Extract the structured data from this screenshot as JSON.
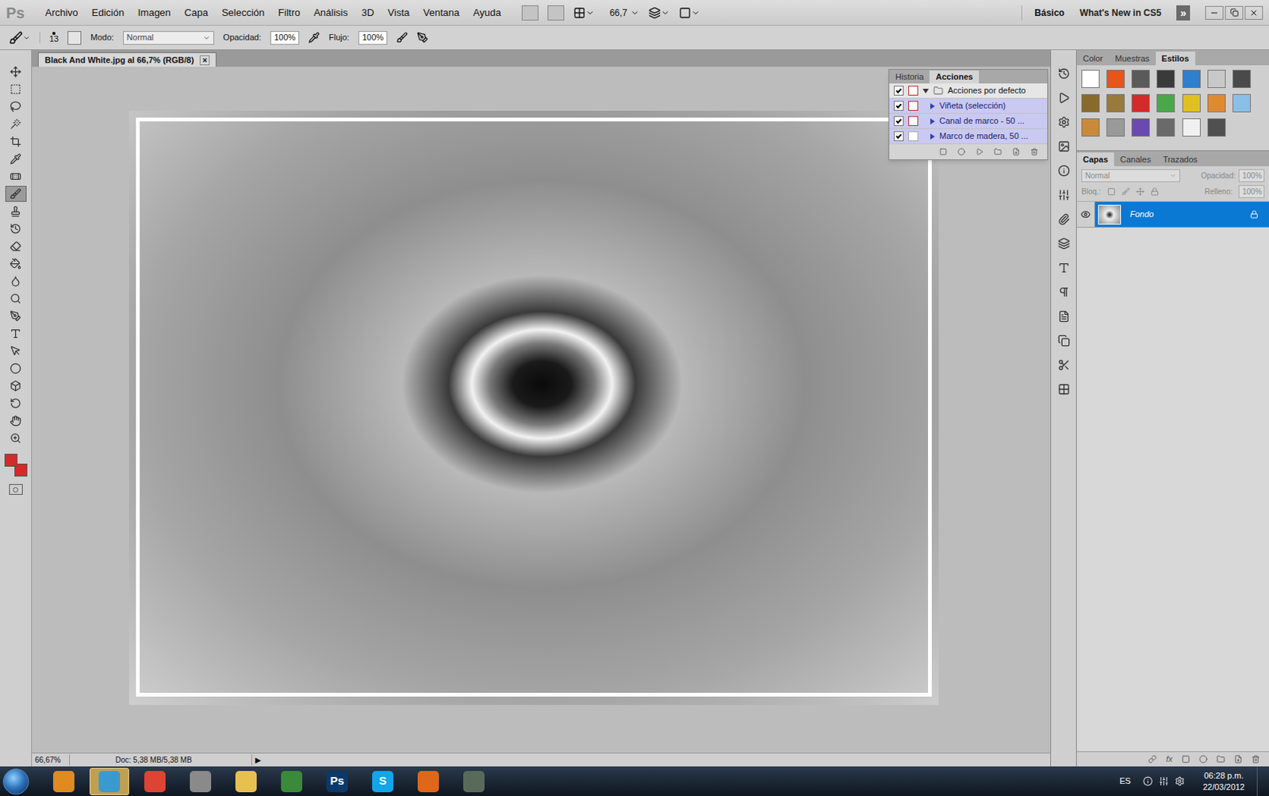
{
  "app": {
    "logo": "Ps"
  },
  "menu": [
    "Archivo",
    "Edición",
    "Imagen",
    "Capa",
    "Selección",
    "Filtro",
    "Análisis",
    "3D",
    "Vista",
    "Ventana",
    "Ayuda"
  ],
  "app_bar": {
    "zoom": "66,7",
    "workspaces": [
      {
        "label": "Básico",
        "selected": true
      },
      {
        "label": "What's New in CS5",
        "selected": false
      }
    ],
    "more": "»"
  },
  "options_bar": {
    "brush_size": "13",
    "mode_label": "Modo:",
    "mode": "Normal",
    "opacity_label": "Opacidad:",
    "opacity": "100%",
    "flow_label": "Flujo:",
    "flow": "100%"
  },
  "document": {
    "title": "Black And White.jpg al 66,7% (RGB/8)",
    "close": "×"
  },
  "tools": [
    {
      "selected": false
    },
    {
      "selected": false
    },
    {
      "selected": false
    },
    {
      "selected": false
    },
    {
      "selected": false
    },
    {
      "selected": false
    },
    {
      "selected": false
    },
    {
      "selected": true
    },
    {
      "selected": false
    },
    {
      "selected": false
    },
    {
      "selected": false
    },
    {
      "selected": false
    },
    {
      "selected": false
    },
    {
      "selected": false
    },
    {
      "selected": false
    },
    {
      "selected": false
    },
    {
      "selected": false
    },
    {
      "selected": false
    },
    {
      "selected": false
    },
    {
      "selected": false
    },
    {
      "selected": false
    },
    {
      "selected": false
    }
  ],
  "colors": {
    "foreground": "#d42a2a",
    "background": "#d42a2a"
  },
  "actions_panel": {
    "tabs": [
      {
        "label": "Historia",
        "selected": false
      },
      {
        "label": "Acciones",
        "selected": true
      }
    ],
    "items": [
      {
        "label": "Acciones por defecto",
        "kind": "set",
        "checked": true,
        "dialog": true,
        "expanded": true
      },
      {
        "label": "Viñeta (selección)",
        "kind": "action",
        "checked": true,
        "dialog": true,
        "expanded": false
      },
      {
        "label": "Canal de marco - 50 ...",
        "kind": "action",
        "checked": true,
        "dialog": true,
        "expanded": false
      },
      {
        "label": "Marco de madera, 50 ...",
        "kind": "action",
        "checked": true,
        "dialog": false,
        "expanded": false
      }
    ]
  },
  "styles_panel": {
    "tabs": [
      {
        "label": "Color",
        "selected": false
      },
      {
        "label": "Muestras",
        "selected": false
      },
      {
        "label": "Estilos",
        "selected": true
      }
    ],
    "swatches": [
      {
        "color": "#ffffff"
      },
      {
        "color": "#e8541a"
      },
      {
        "color": "#5a5a5a"
      },
      {
        "color": "#3a3a3a"
      },
      {
        "color": "#2d7fd0"
      },
      {
        "color": "#c8c8c8"
      },
      {
        "color": "#4a4a4a"
      },
      {
        "color": "#8a6a2a"
      },
      {
        "color": "#9a7a3a"
      },
      {
        "color": "#d42a2a"
      },
      {
        "color": "#4aa84a"
      },
      {
        "color": "#e0c020"
      },
      {
        "color": "#e08a30"
      },
      {
        "color": "#8ac0e8"
      },
      {
        "color": "#c88a3a"
      },
      {
        "color": "#9a9a9a"
      },
      {
        "color": "#6a4ab0"
      },
      {
        "color": "#6a6a6a"
      },
      {
        "color": "#f0f0f0"
      },
      {
        "color": "#505050"
      }
    ]
  },
  "layers_panel": {
    "tabs": [
      {
        "label": "Capas",
        "selected": true
      },
      {
        "label": "Canales",
        "selected": false
      },
      {
        "label": "Trazados",
        "selected": false
      }
    ],
    "mode": "Normal",
    "opacity_label": "Opacidad:",
    "opacity": "100%",
    "lock_label": "Bloq.:",
    "fill_label": "Relleno:",
    "fill": "100%",
    "layers": [
      {
        "name": "Fondo",
        "visible": true,
        "locked": true,
        "selected": true
      }
    ],
    "footer_fx": "fx"
  },
  "status_bar": {
    "zoom": "66,67%",
    "doc": "Doc: 5,38 MB/5,38 MB",
    "arrow": "▶"
  },
  "taskbar": {
    "apps": [
      {
        "label": "",
        "color": "#e08a20"
      },
      {
        "label": "",
        "color": "#3a9ad0"
      },
      {
        "label": "",
        "color": "#dd4433"
      },
      {
        "label": "",
        "color": "#8a8a8a"
      },
      {
        "label": "",
        "color": "#e8c050"
      },
      {
        "label": "",
        "color": "#3a8a3a"
      },
      {
        "label": "Ps",
        "color": "#0a3a6a"
      },
      {
        "label": "S",
        "color": "#12a5e8"
      },
      {
        "label": "",
        "color": "#e0661a"
      },
      {
        "label": "",
        "color": "#5a6a5a"
      }
    ],
    "active_app": 1,
    "language": "ES",
    "time": "06:28 p.m.",
    "date": "22/03/2012"
  }
}
